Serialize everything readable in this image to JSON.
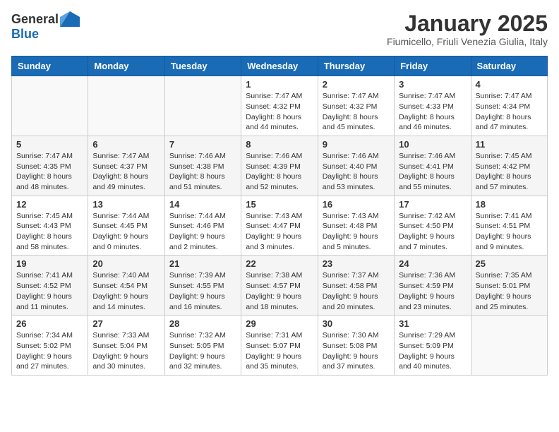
{
  "header": {
    "logo_general": "General",
    "logo_blue": "Blue",
    "month_title": "January 2025",
    "location": "Fiumicello, Friuli Venezia Giulia, Italy"
  },
  "days_of_week": [
    "Sunday",
    "Monday",
    "Tuesday",
    "Wednesday",
    "Thursday",
    "Friday",
    "Saturday"
  ],
  "weeks": [
    [
      {
        "day": "",
        "info": ""
      },
      {
        "day": "",
        "info": ""
      },
      {
        "day": "",
        "info": ""
      },
      {
        "day": "1",
        "info": "Sunrise: 7:47 AM\nSunset: 4:32 PM\nDaylight: 8 hours\nand 44 minutes."
      },
      {
        "day": "2",
        "info": "Sunrise: 7:47 AM\nSunset: 4:32 PM\nDaylight: 8 hours\nand 45 minutes."
      },
      {
        "day": "3",
        "info": "Sunrise: 7:47 AM\nSunset: 4:33 PM\nDaylight: 8 hours\nand 46 minutes."
      },
      {
        "day": "4",
        "info": "Sunrise: 7:47 AM\nSunset: 4:34 PM\nDaylight: 8 hours\nand 47 minutes."
      }
    ],
    [
      {
        "day": "5",
        "info": "Sunrise: 7:47 AM\nSunset: 4:35 PM\nDaylight: 8 hours\nand 48 minutes."
      },
      {
        "day": "6",
        "info": "Sunrise: 7:47 AM\nSunset: 4:37 PM\nDaylight: 8 hours\nand 49 minutes."
      },
      {
        "day": "7",
        "info": "Sunrise: 7:46 AM\nSunset: 4:38 PM\nDaylight: 8 hours\nand 51 minutes."
      },
      {
        "day": "8",
        "info": "Sunrise: 7:46 AM\nSunset: 4:39 PM\nDaylight: 8 hours\nand 52 minutes."
      },
      {
        "day": "9",
        "info": "Sunrise: 7:46 AM\nSunset: 4:40 PM\nDaylight: 8 hours\nand 53 minutes."
      },
      {
        "day": "10",
        "info": "Sunrise: 7:46 AM\nSunset: 4:41 PM\nDaylight: 8 hours\nand 55 minutes."
      },
      {
        "day": "11",
        "info": "Sunrise: 7:45 AM\nSunset: 4:42 PM\nDaylight: 8 hours\nand 57 minutes."
      }
    ],
    [
      {
        "day": "12",
        "info": "Sunrise: 7:45 AM\nSunset: 4:43 PM\nDaylight: 8 hours\nand 58 minutes."
      },
      {
        "day": "13",
        "info": "Sunrise: 7:44 AM\nSunset: 4:45 PM\nDaylight: 9 hours\nand 0 minutes."
      },
      {
        "day": "14",
        "info": "Sunrise: 7:44 AM\nSunset: 4:46 PM\nDaylight: 9 hours\nand 2 minutes."
      },
      {
        "day": "15",
        "info": "Sunrise: 7:43 AM\nSunset: 4:47 PM\nDaylight: 9 hours\nand 3 minutes."
      },
      {
        "day": "16",
        "info": "Sunrise: 7:43 AM\nSunset: 4:48 PM\nDaylight: 9 hours\nand 5 minutes."
      },
      {
        "day": "17",
        "info": "Sunrise: 7:42 AM\nSunset: 4:50 PM\nDaylight: 9 hours\nand 7 minutes."
      },
      {
        "day": "18",
        "info": "Sunrise: 7:41 AM\nSunset: 4:51 PM\nDaylight: 9 hours\nand 9 minutes."
      }
    ],
    [
      {
        "day": "19",
        "info": "Sunrise: 7:41 AM\nSunset: 4:52 PM\nDaylight: 9 hours\nand 11 minutes."
      },
      {
        "day": "20",
        "info": "Sunrise: 7:40 AM\nSunset: 4:54 PM\nDaylight: 9 hours\nand 14 minutes."
      },
      {
        "day": "21",
        "info": "Sunrise: 7:39 AM\nSunset: 4:55 PM\nDaylight: 9 hours\nand 16 minutes."
      },
      {
        "day": "22",
        "info": "Sunrise: 7:38 AM\nSunset: 4:57 PM\nDaylight: 9 hours\nand 18 minutes."
      },
      {
        "day": "23",
        "info": "Sunrise: 7:37 AM\nSunset: 4:58 PM\nDaylight: 9 hours\nand 20 minutes."
      },
      {
        "day": "24",
        "info": "Sunrise: 7:36 AM\nSunset: 4:59 PM\nDaylight: 9 hours\nand 23 minutes."
      },
      {
        "day": "25",
        "info": "Sunrise: 7:35 AM\nSunset: 5:01 PM\nDaylight: 9 hours\nand 25 minutes."
      }
    ],
    [
      {
        "day": "26",
        "info": "Sunrise: 7:34 AM\nSunset: 5:02 PM\nDaylight: 9 hours\nand 27 minutes."
      },
      {
        "day": "27",
        "info": "Sunrise: 7:33 AM\nSunset: 5:04 PM\nDaylight: 9 hours\nand 30 minutes."
      },
      {
        "day": "28",
        "info": "Sunrise: 7:32 AM\nSunset: 5:05 PM\nDaylight: 9 hours\nand 32 minutes."
      },
      {
        "day": "29",
        "info": "Sunrise: 7:31 AM\nSunset: 5:07 PM\nDaylight: 9 hours\nand 35 minutes."
      },
      {
        "day": "30",
        "info": "Sunrise: 7:30 AM\nSunset: 5:08 PM\nDaylight: 9 hours\nand 37 minutes."
      },
      {
        "day": "31",
        "info": "Sunrise: 7:29 AM\nSunset: 5:09 PM\nDaylight: 9 hours\nand 40 minutes."
      },
      {
        "day": "",
        "info": ""
      }
    ]
  ]
}
